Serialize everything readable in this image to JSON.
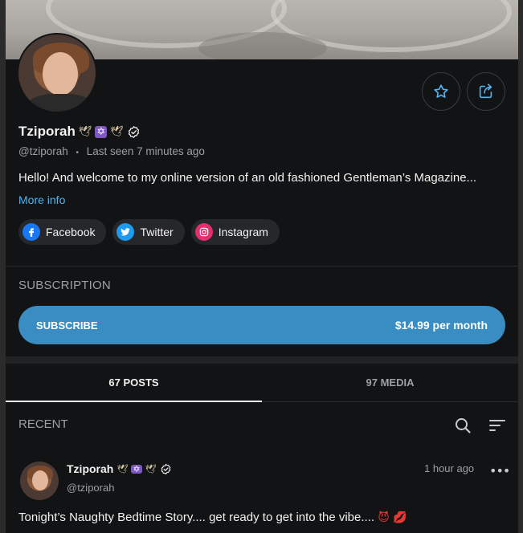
{
  "profile": {
    "name": "Tziporah",
    "handle": "@tziporah",
    "separator": "•",
    "last_seen": "Last seen 7 minutes ago",
    "bio": "Hello! And welcome to my online version of an old fashioned Gentleman’s Magazine...",
    "more_info": "More info",
    "name_emojis": [
      "🕊",
      "✡",
      "🕊"
    ]
  },
  "actions": {
    "favorite_icon": "star-icon",
    "share_icon": "share-icon"
  },
  "socials": [
    {
      "label": "Facebook",
      "icon": "facebook-icon",
      "color": "#1877f2"
    },
    {
      "label": "Twitter",
      "icon": "twitter-icon",
      "color": "#1d9bf0"
    },
    {
      "label": "Instagram",
      "icon": "instagram-icon",
      "color": "#e1306c"
    }
  ],
  "subscription": {
    "title": "SUBSCRIPTION",
    "button_label": "SUBSCRIBE",
    "price": "$14.99 per month",
    "accent": "#3a8dc2"
  },
  "tabs": [
    {
      "label": "67 POSTS",
      "active": true
    },
    {
      "label": "97 MEDIA",
      "active": false
    }
  ],
  "feed": {
    "section_title": "RECENT",
    "search_icon": "search-icon",
    "sort_icon": "sort-icon"
  },
  "post": {
    "author": "Tziporah",
    "handle": "@tziporah",
    "time": "1 hour ago",
    "menu": "•••",
    "text": "Tonight’s Naughty Bedtime Story.... get ready to get into the vibe.... ",
    "text_emojis": "😈 💋"
  }
}
